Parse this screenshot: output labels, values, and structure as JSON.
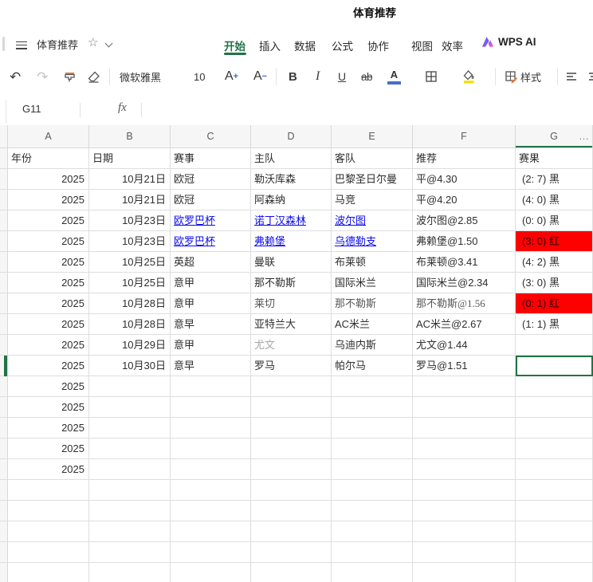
{
  "title_bar": {
    "title": "体育推荐"
  },
  "menu_bar": {
    "doc_title": "体育推荐",
    "star_icon": "☆",
    "tabs": [
      {
        "label": "开始",
        "active": true
      },
      {
        "label": "插入",
        "active": false
      },
      {
        "label": "数据",
        "active": false
      },
      {
        "label": "公式",
        "active": false
      },
      {
        "label": "协作",
        "active": false
      },
      {
        "label": "视图",
        "active": false
      },
      {
        "label": "效率",
        "active": false
      }
    ],
    "wps_ai_label": "WPS AI"
  },
  "toolbar": {
    "undo_icon": "↶",
    "redo_icon": "↷",
    "font_name": "微软雅黑",
    "font_size": "10",
    "grow_font": "A",
    "shrink_font": "A",
    "bold_label": "B",
    "italic_label": "I",
    "underline_label": "U",
    "strike_label": "ab",
    "font_color_label": "A",
    "style_label": "样式"
  },
  "formula_bar": {
    "name_box": "G11",
    "fx_label": "fx"
  },
  "sheet": {
    "column_letters": [
      "A",
      "B",
      "C",
      "D",
      "E",
      "F",
      "G"
    ],
    "more_columns_indicator": "…",
    "selected_cell": "G11",
    "header_row": [
      "年份",
      "日期",
      "赛事",
      "主队",
      "客队",
      "推荐",
      "赛果"
    ],
    "rows": [
      {
        "cells": [
          "2025",
          "10月21日",
          "欧冠",
          "勒沃库森",
          "巴黎圣日尔曼",
          "平@4.30",
          "(2: 7) 黑"
        ]
      },
      {
        "cells": [
          "2025",
          "10月21日",
          "欧冠",
          "阿森纳",
          "马竞",
          "平@4.20",
          "(4: 0) 黑"
        ]
      },
      {
        "cells": [
          "2025",
          "10月23日",
          {
            "t": "欧罗巴杯",
            "s": "lnk"
          },
          {
            "t": "诺丁汉森林",
            "s": "lnk"
          },
          {
            "t": "波尔图",
            "s": "lnk"
          },
          "波尔图@2.85",
          "(0: 0) 黑"
        ]
      },
      {
        "cells": [
          "2025",
          "10月23日",
          {
            "t": "欧罗巴杯",
            "s": "lnk"
          },
          {
            "t": "弗赖堡",
            "s": "lnk"
          },
          {
            "t": "乌德勒支",
            "s": "lnk"
          },
          "弗赖堡@1.50",
          {
            "t": "(3: 0) 红",
            "s": "red"
          }
        ]
      },
      {
        "cells": [
          "2025",
          "10月25日",
          "英超",
          "曼联",
          "布莱顿",
          "布莱顿@3.41",
          "(4: 2) 黑"
        ]
      },
      {
        "cells": [
          "2025",
          "10月25日",
          "意甲",
          "那不勒斯",
          "国际米兰",
          "国际米兰@2.34",
          "(3: 0) 黑"
        ]
      },
      {
        "cells": [
          "2025",
          "10月28日",
          "意甲",
          {
            "t": "莱切",
            "s": "srf"
          },
          {
            "t": "那不勒斯",
            "s": "srf"
          },
          {
            "t": "那不勒斯@1.56",
            "s": "srf"
          },
          {
            "t": "(0: 1) 红",
            "s": "red"
          }
        ]
      },
      {
        "cells": [
          "2025",
          "10月28日",
          "意早",
          "亚特兰大",
          "AC米兰",
          "AC米兰@2.67",
          "(1: 1) 黑"
        ]
      },
      {
        "cells": [
          "2025",
          "10月29日",
          "意甲",
          {
            "t": "尤文",
            "s": "gsrf"
          },
          "乌迪内斯",
          "尤文@1.44",
          ""
        ]
      },
      {
        "cells": [
          "2025",
          "10月30日",
          "意早",
          "罗马",
          "帕尔马",
          "罗马@1.51",
          ""
        ]
      },
      {
        "cells": [
          "2025",
          "",
          "",
          "",
          "",
          "",
          ""
        ]
      },
      {
        "cells": [
          "2025",
          "",
          "",
          "",
          "",
          "",
          ""
        ]
      },
      {
        "cells": [
          "2025",
          "",
          "",
          "",
          "",
          "",
          ""
        ]
      },
      {
        "cells": [
          "2025",
          "",
          "",
          "",
          "",
          "",
          ""
        ]
      },
      {
        "cells": [
          "2025",
          "",
          "",
          "",
          "",
          "",
          ""
        ]
      },
      {
        "cells": [
          "",
          "",
          "",
          "",
          "",
          "",
          ""
        ]
      },
      {
        "cells": [
          "",
          "",
          "",
          "",
          "",
          "",
          ""
        ]
      },
      {
        "cells": [
          "",
          "",
          "",
          "",
          "",
          "",
          ""
        ]
      },
      {
        "cells": [
          "",
          "",
          "",
          "",
          "",
          "",
          ""
        ]
      },
      {
        "cells": [
          "",
          "",
          "",
          "",
          "",
          "",
          ""
        ]
      }
    ]
  },
  "colors": {
    "accent_green": "#217346",
    "link_blue": "#0b0bef",
    "result_red": "#fe0000",
    "font_color_swatch": "#4472c4",
    "fill_color_swatch": "#f3e003"
  }
}
